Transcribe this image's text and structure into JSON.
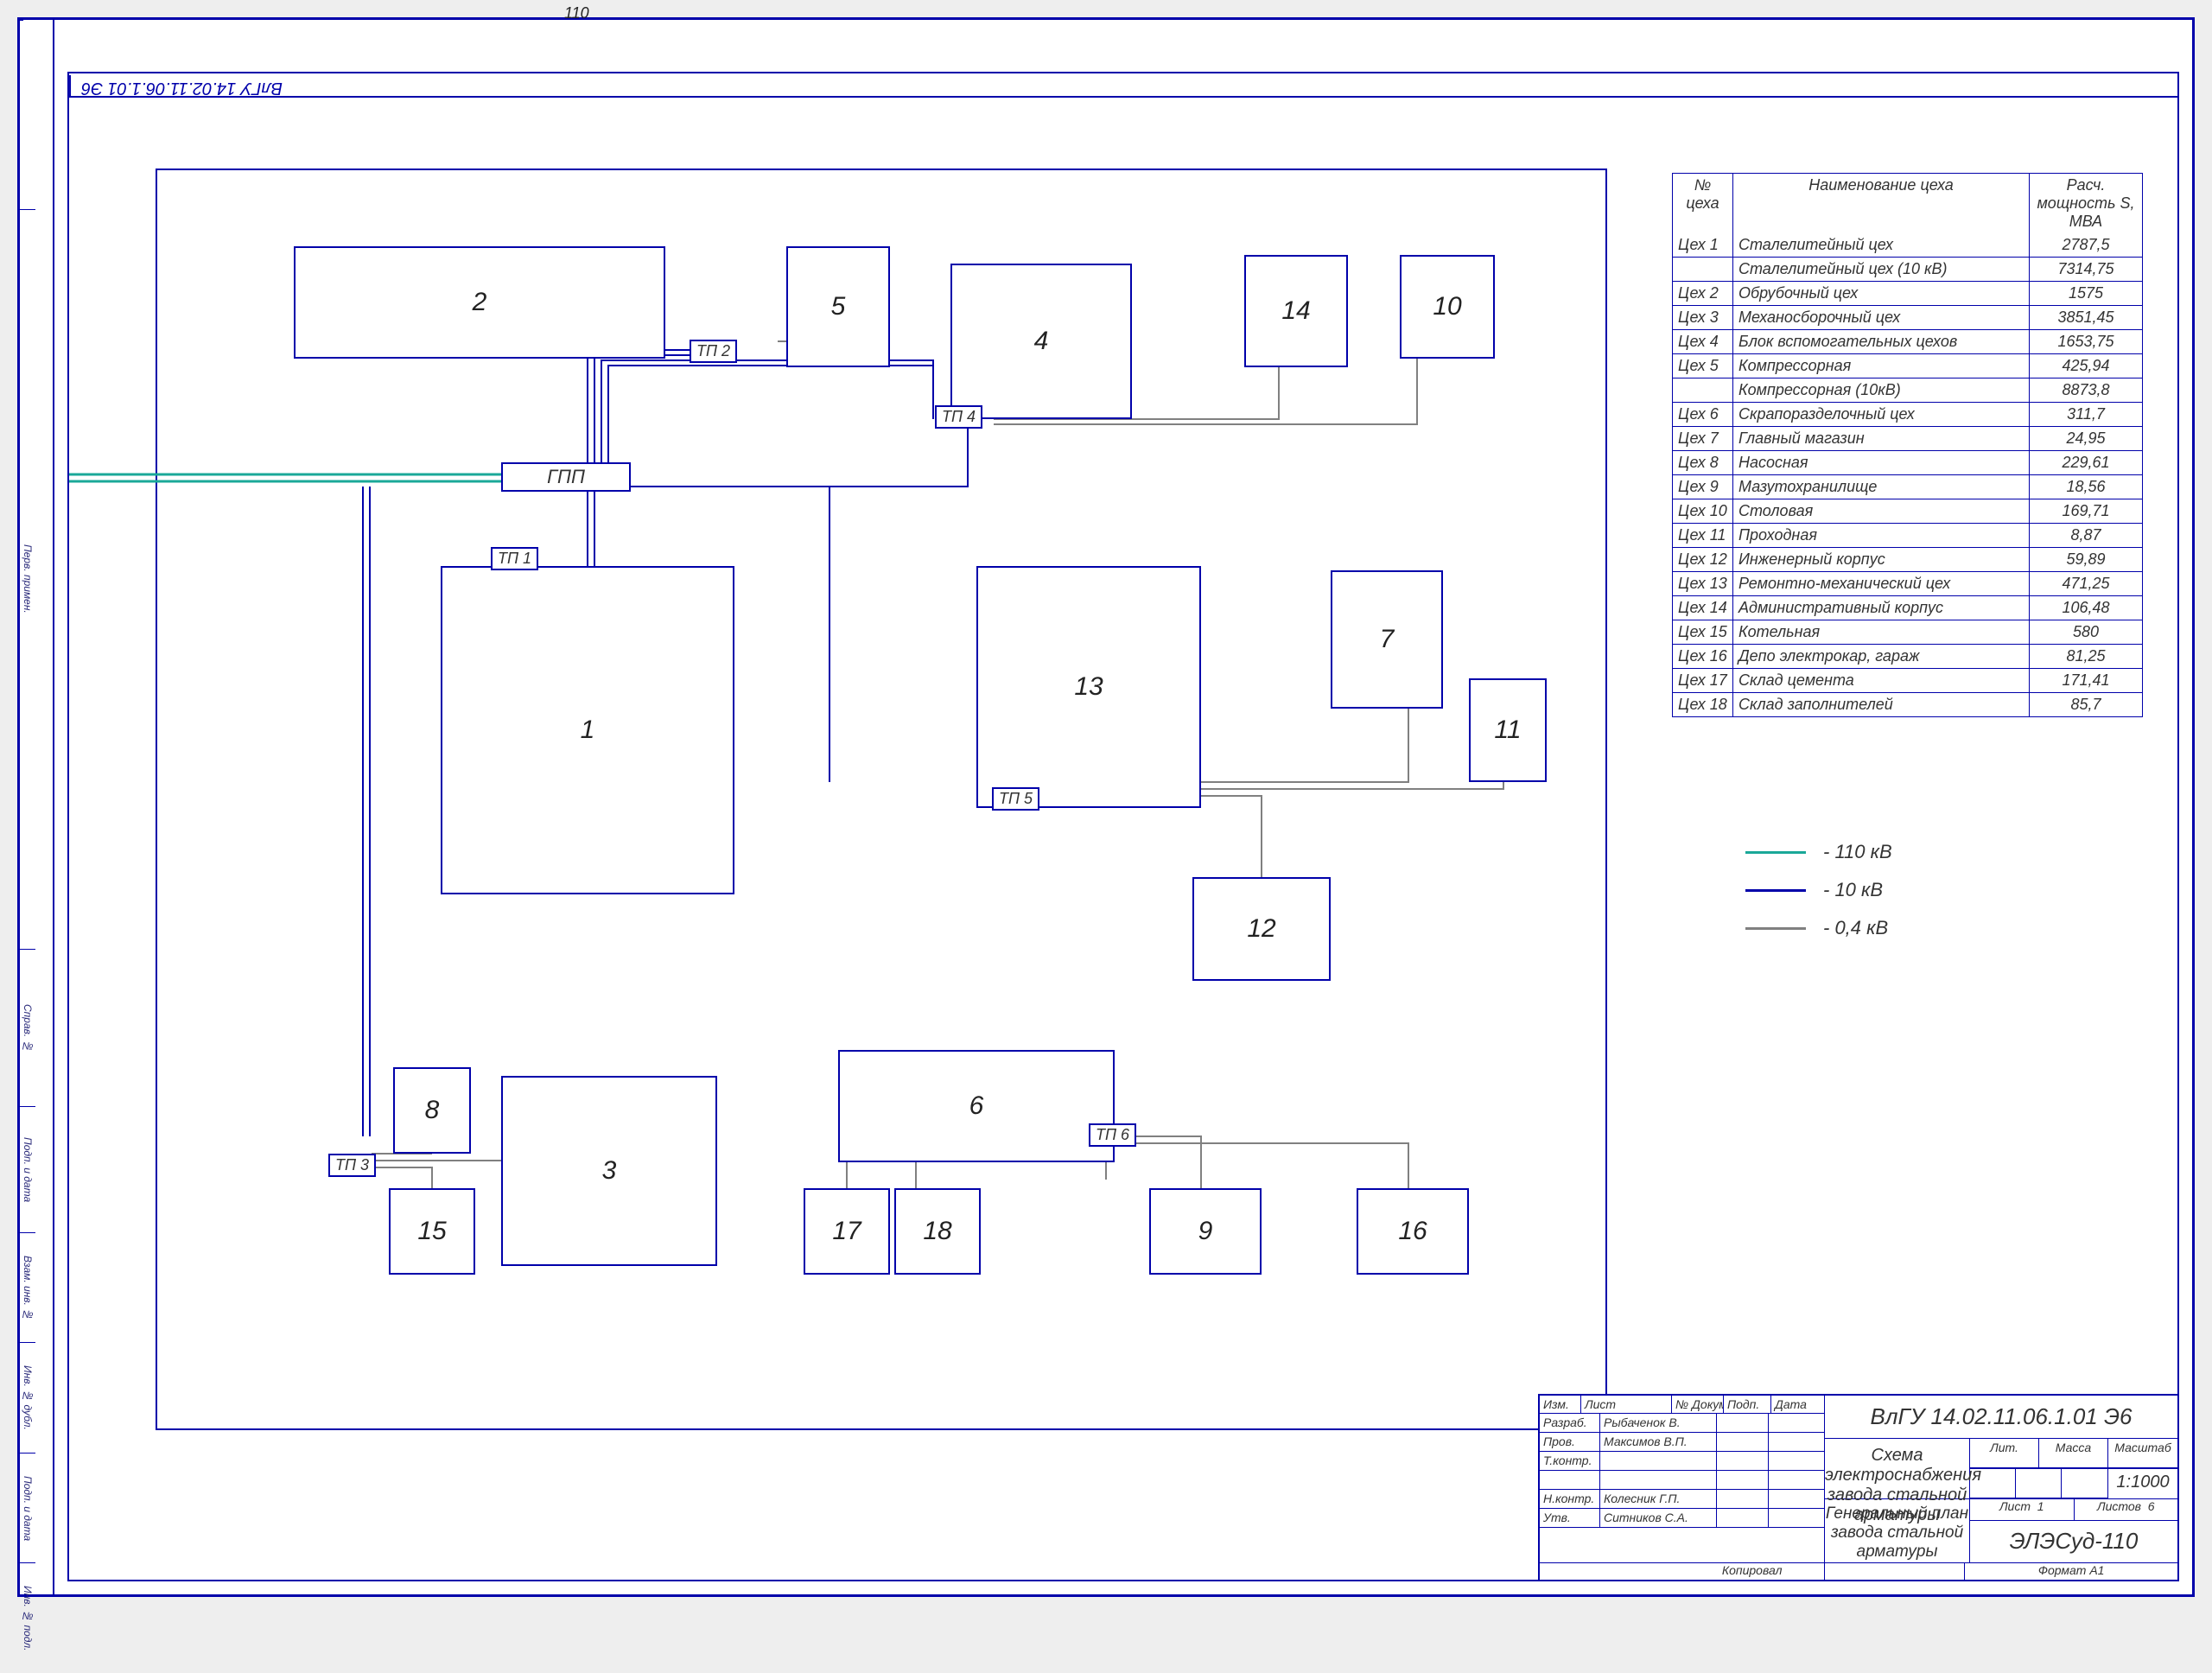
{
  "page_number": "110",
  "doc_code_side": "ВлГУ 14.02.11.06.1.01 Э6",
  "plan_labels": {
    "gpp": "ГПП",
    "tp": [
      "ТП 1",
      "ТП 2",
      "ТП 3",
      "ТП 4",
      "ТП 5",
      "ТП 6"
    ]
  },
  "blocks": [
    {
      "num": "1"
    },
    {
      "num": "2"
    },
    {
      "num": "3"
    },
    {
      "num": "4"
    },
    {
      "num": "5"
    },
    {
      "num": "6"
    },
    {
      "num": "7"
    },
    {
      "num": "8"
    },
    {
      "num": "9"
    },
    {
      "num": "10"
    },
    {
      "num": "11"
    },
    {
      "num": "12"
    },
    {
      "num": "13"
    },
    {
      "num": "14"
    },
    {
      "num": "15"
    },
    {
      "num": "16"
    },
    {
      "num": "17"
    },
    {
      "num": "18"
    }
  ],
  "table": {
    "headers": {
      "col1": "№ цеха",
      "col2": "Наименование цеха",
      "col3": "Расч. мощность S, МВА"
    },
    "rows": [
      {
        "id": "Цех 1",
        "name": "Сталелитейный цех",
        "val": "2787,5"
      },
      {
        "id": "",
        "name": "Сталелитейный цех (10 кВ)",
        "val": "7314,75"
      },
      {
        "id": "Цех 2",
        "name": "Обрубочный цех",
        "val": "1575"
      },
      {
        "id": "Цех 3",
        "name": "Механосборочный цех",
        "val": "3851,45"
      },
      {
        "id": "Цех 4",
        "name": "Блок вспомогательных цехов",
        "val": "1653,75"
      },
      {
        "id": "Цех 5",
        "name": "Компрессорная",
        "val": "425,94"
      },
      {
        "id": "",
        "name": "Компрессорная (10кВ)",
        "val": "8873,8"
      },
      {
        "id": "Цех 6",
        "name": "Скрапоразделочный цех",
        "val": "311,7"
      },
      {
        "id": "Цех 7",
        "name": "Главный магазин",
        "val": "24,95"
      },
      {
        "id": "Цех 8",
        "name": "Насосная",
        "val": "229,61"
      },
      {
        "id": "Цех 9",
        "name": "Мазутохранилище",
        "val": "18,56"
      },
      {
        "id": "Цех 10",
        "name": "Столовая",
        "val": "169,71"
      },
      {
        "id": "Цех 11",
        "name": "Проходная",
        "val": "8,87"
      },
      {
        "id": "Цех 12",
        "name": "Инженерный корпус",
        "val": "59,89"
      },
      {
        "id": "Цех 13",
        "name": "Ремонтно-механический цех",
        "val": "471,25"
      },
      {
        "id": "Цех 14",
        "name": "Административный корпус",
        "val": "106,48"
      },
      {
        "id": "Цех 15",
        "name": "Котельная",
        "val": "580"
      },
      {
        "id": "Цех 16",
        "name": "Депо электрокар, гараж",
        "val": "81,25"
      },
      {
        "id": "Цех 17",
        "name": "Склад цемента",
        "val": "171,41"
      },
      {
        "id": "Цех 18",
        "name": "Склад заполнителей",
        "val": "85,7"
      }
    ]
  },
  "legend": [
    {
      "color": "#1aa898",
      "label": "- 110 кВ"
    },
    {
      "color": "#0000aa",
      "label": "- 10 кВ"
    },
    {
      "color": "#808080",
      "label": "- 0,4 кВ"
    }
  ],
  "titleblock": {
    "doc_code": "ВлГУ 14.02.11.06.1.01 Э6",
    "desc1": "Схема электроснабжения",
    "desc2": "завода стальной арматуры",
    "desc3": "Генеральный план",
    "desc4": "завода стальной арматуры",
    "project": "ЭЛЭСуд-110",
    "scale": "1:1000",
    "lit": "Лит.",
    "massa": "Масса",
    "mash": "Масштаб",
    "list": "Лист",
    "list_n": "1",
    "listov": "Листов",
    "listov_n": "6",
    "razrab": "Разраб.",
    "prov": "Пров.",
    "tkontr": "Т.контр.",
    "nkontr": "Н.контр.",
    "utv": "Утв.",
    "name1": "Рыбаченок В.",
    "name2": "Максимов В.П.",
    "name3": "Колесник Г.П.",
    "name4": "Ситников С.А.",
    "hdr_izm": "Изм.",
    "hdr_list": "Лист",
    "hdr_doc": "№ Докум.",
    "hdr_podp": "Подп.",
    "hdr_data": "Дата",
    "kopiroval": "Копировал",
    "format": "Формат   A1"
  },
  "side_labels": [
    "Подп. и дата",
    "Инв. № дубл.",
    "Взам. инв. №",
    "Подп. и дата",
    "Инв. № подл.",
    "Справ. №",
    "Перв. примен."
  ]
}
